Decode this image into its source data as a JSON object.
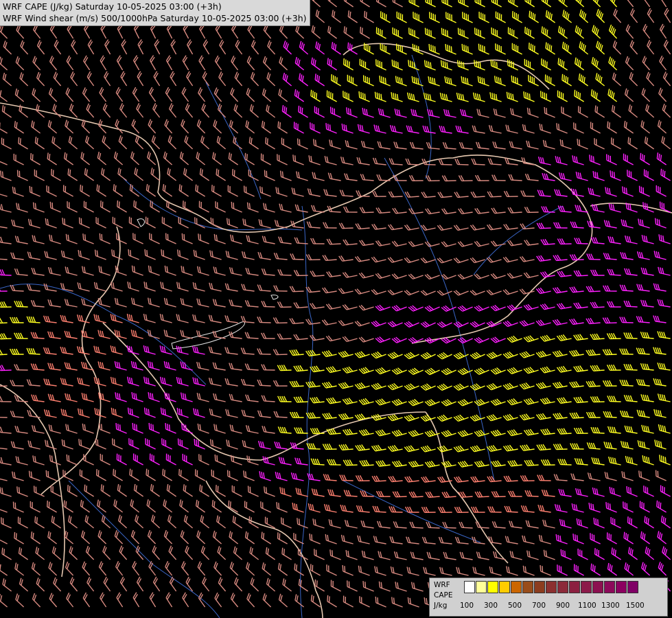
{
  "header": {
    "line1": "WRF CAPE (J/kg) Saturday 10-05-2025 03:00 (+3h)",
    "line2": "WRF Wind shear (m/s) 500/1000hPa Saturday 10-05-2025 03:00 (+3h)"
  },
  "legend": {
    "label_lines": [
      "WRF",
      "CAPE",
      "J/kg"
    ],
    "swatch_colors": [
      "#ffffff",
      "#ffff99",
      "#ffff00",
      "#ffcc00",
      "#cc6600",
      "#994d1a",
      "#8c3d1f",
      "#8c3030",
      "#8c2a3a",
      "#8c2040",
      "#8c1a4a",
      "#8c1050",
      "#8c0a5a",
      "#8c0060",
      "#800066"
    ],
    "tick_labels": [
      "100",
      "300",
      "500",
      "700",
      "900",
      "1100",
      "1300",
      "1500"
    ]
  },
  "colors": {
    "barb_default": "#d88a80",
    "barb_strong": "#ff8070",
    "barb_magenta": "#ff20ff",
    "barb_yellow": "#ffff20",
    "border": "#e6c8b0",
    "river": "#3a66c8"
  },
  "icons": {
    "wind_barb": "wind-barb-icon",
    "lake": "lake-outline-icon"
  }
}
